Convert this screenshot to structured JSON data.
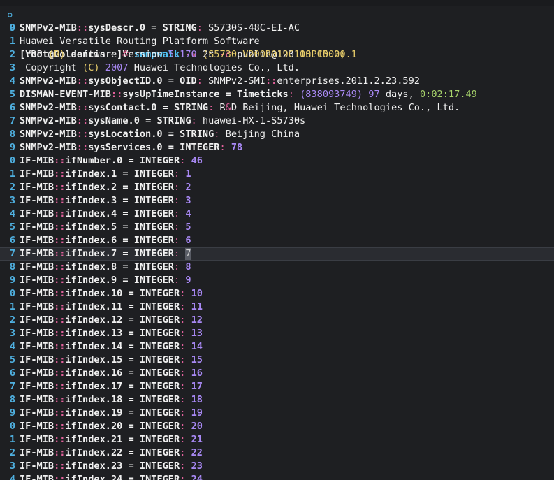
{
  "top_fragment": "- ——————— —— —— —— ——",
  "prompt": {
    "line_number": "9",
    "user_host": "[root@Goldencis ~]",
    "hash": "#",
    "command": "snmpwalk",
    "flag_v": "-v",
    "version": "2c",
    "flag_c": "-c",
    "community": "public@123",
    "target": "10.10.20.1"
  },
  "lines": [
    {
      "gutter": "0",
      "segments": [
        [
          "obj",
          "SNMPv2-MIB"
        ],
        [
          "sep",
          "::"
        ],
        [
          "obj",
          "sysDescr.0 "
        ],
        [
          "eq",
          "= "
        ],
        [
          "type",
          "STRING"
        ],
        [
          "colon",
          ": "
        ],
        [
          "str",
          "S5730S-48C-EI-AC"
        ]
      ]
    },
    {
      "gutter": "1",
      "segments": [
        [
          "plain",
          "Huawei Versatile Routing Platform Software"
        ]
      ]
    },
    {
      "gutter": "2",
      "segments": [
        [
          "plain",
          " VRP "
        ],
        [
          "paren",
          "(R)"
        ],
        [
          "plain",
          " software,Version "
        ],
        [
          "ver",
          "5.170"
        ],
        [
          "plain",
          " "
        ],
        [
          "paren",
          "(S5730 V200R019C10SPC500)"
        ]
      ]
    },
    {
      "gutter": "3",
      "segments": [
        [
          "plain",
          " Copyright "
        ],
        [
          "paren",
          "(C)"
        ],
        [
          "plain",
          " "
        ],
        [
          "ver",
          "2007"
        ],
        [
          "plain",
          " Huawei Technologies Co., Ltd."
        ]
      ]
    },
    {
      "gutter": "4",
      "segments": [
        [
          "obj",
          "SNMPv2-MIB"
        ],
        [
          "sep",
          "::"
        ],
        [
          "obj",
          "sysObjectID.0 "
        ],
        [
          "eq",
          "= "
        ],
        [
          "type",
          "OID"
        ],
        [
          "colon",
          ": "
        ],
        [
          "str",
          "SNMPv2-SMI"
        ],
        [
          "sep",
          "::"
        ],
        [
          "str",
          "enterprises.2011.2.23.592"
        ]
      ]
    },
    {
      "gutter": "5",
      "segments": [
        [
          "obj",
          "DISMAN-EVENT-MIB"
        ],
        [
          "sep",
          "::"
        ],
        [
          "obj",
          "sysUpTimeInstance "
        ],
        [
          "eq",
          "= "
        ],
        [
          "type",
          "Timeticks"
        ],
        [
          "colon",
          ": "
        ],
        [
          "ts",
          "(838093749)"
        ],
        [
          "plain",
          " "
        ],
        [
          "ts",
          "97"
        ],
        [
          "plain",
          " days, "
        ],
        [
          "ts2",
          "0:02:17.49"
        ]
      ]
    },
    {
      "gutter": "6",
      "segments": [
        [
          "obj",
          "SNMPv2-MIB"
        ],
        [
          "sep",
          "::"
        ],
        [
          "obj",
          "sysContact.0 "
        ],
        [
          "eq",
          "= "
        ],
        [
          "type",
          "STRING"
        ],
        [
          "colon",
          ": "
        ],
        [
          "str",
          "R"
        ],
        [
          "amp",
          "&"
        ],
        [
          "str",
          "D Beijing, Huawei Technologies Co., Ltd."
        ]
      ]
    },
    {
      "gutter": "7",
      "segments": [
        [
          "obj",
          "SNMPv2-MIB"
        ],
        [
          "sep",
          "::"
        ],
        [
          "obj",
          "sysName.0 "
        ],
        [
          "eq",
          "= "
        ],
        [
          "type",
          "STRING"
        ],
        [
          "colon",
          ": "
        ],
        [
          "str",
          "huawei-HX-1-S5730s"
        ]
      ]
    },
    {
      "gutter": "8",
      "segments": [
        [
          "obj",
          "SNMPv2-MIB"
        ],
        [
          "sep",
          "::"
        ],
        [
          "obj",
          "sysLocation.0 "
        ],
        [
          "eq",
          "= "
        ],
        [
          "type",
          "STRING"
        ],
        [
          "colon",
          ": "
        ],
        [
          "str",
          "Beijing China"
        ]
      ]
    },
    {
      "gutter": "9",
      "segments": [
        [
          "obj",
          "SNMPv2-MIB"
        ],
        [
          "sep",
          "::"
        ],
        [
          "obj",
          "sysServices.0 "
        ],
        [
          "eq",
          "= "
        ],
        [
          "type",
          "INTEGER"
        ],
        [
          "colon",
          ": "
        ],
        [
          "num",
          "78"
        ]
      ]
    },
    {
      "gutter": "0",
      "segments": [
        [
          "obj",
          "IF-MIB"
        ],
        [
          "sep",
          "::"
        ],
        [
          "obj",
          "ifNumber.0 "
        ],
        [
          "eq",
          "= "
        ],
        [
          "type",
          "INTEGER"
        ],
        [
          "colon",
          ": "
        ],
        [
          "num",
          "46"
        ]
      ]
    },
    {
      "gutter": "1",
      "segments": [
        [
          "obj",
          "IF-MIB"
        ],
        [
          "sep",
          "::"
        ],
        [
          "obj",
          "ifIndex.1 "
        ],
        [
          "eq",
          "= "
        ],
        [
          "type",
          "INTEGER"
        ],
        [
          "colon",
          ": "
        ],
        [
          "num",
          "1"
        ]
      ]
    },
    {
      "gutter": "2",
      "segments": [
        [
          "obj",
          "IF-MIB"
        ],
        [
          "sep",
          "::"
        ],
        [
          "obj",
          "ifIndex.2 "
        ],
        [
          "eq",
          "= "
        ],
        [
          "type",
          "INTEGER"
        ],
        [
          "colon",
          ": "
        ],
        [
          "num",
          "2"
        ]
      ]
    },
    {
      "gutter": "3",
      "segments": [
        [
          "obj",
          "IF-MIB"
        ],
        [
          "sep",
          "::"
        ],
        [
          "obj",
          "ifIndex.3 "
        ],
        [
          "eq",
          "= "
        ],
        [
          "type",
          "INTEGER"
        ],
        [
          "colon",
          ": "
        ],
        [
          "num",
          "3"
        ]
      ]
    },
    {
      "gutter": "4",
      "segments": [
        [
          "obj",
          "IF-MIB"
        ],
        [
          "sep",
          "::"
        ],
        [
          "obj",
          "ifIndex.4 "
        ],
        [
          "eq",
          "= "
        ],
        [
          "type",
          "INTEGER"
        ],
        [
          "colon",
          ": "
        ],
        [
          "num",
          "4"
        ]
      ]
    },
    {
      "gutter": "5",
      "segments": [
        [
          "obj",
          "IF-MIB"
        ],
        [
          "sep",
          "::"
        ],
        [
          "obj",
          "ifIndex.5 "
        ],
        [
          "eq",
          "= "
        ],
        [
          "type",
          "INTEGER"
        ],
        [
          "colon",
          ": "
        ],
        [
          "num",
          "5"
        ]
      ]
    },
    {
      "gutter": "6",
      "segments": [
        [
          "obj",
          "IF-MIB"
        ],
        [
          "sep",
          "::"
        ],
        [
          "obj",
          "ifIndex.6 "
        ],
        [
          "eq",
          "= "
        ],
        [
          "type",
          "INTEGER"
        ],
        [
          "colon",
          ": "
        ],
        [
          "num",
          "6"
        ]
      ]
    },
    {
      "gutter": "7",
      "current": true,
      "segments": [
        [
          "obj",
          "IF-MIB"
        ],
        [
          "sep",
          "::"
        ],
        [
          "obj",
          "ifIndex.7 "
        ],
        [
          "eq",
          "= "
        ],
        [
          "type",
          "INTEGER"
        ],
        [
          "colon",
          ": "
        ],
        [
          "cursor",
          "7"
        ]
      ]
    },
    {
      "gutter": "8",
      "segments": [
        [
          "obj",
          "IF-MIB"
        ],
        [
          "sep",
          "::"
        ],
        [
          "obj",
          "ifIndex.8 "
        ],
        [
          "eq",
          "= "
        ],
        [
          "type",
          "INTEGER"
        ],
        [
          "colon",
          ": "
        ],
        [
          "num",
          "8"
        ]
      ]
    },
    {
      "gutter": "9",
      "segments": [
        [
          "obj",
          "IF-MIB"
        ],
        [
          "sep",
          "::"
        ],
        [
          "obj",
          "ifIndex.9 "
        ],
        [
          "eq",
          "= "
        ],
        [
          "type",
          "INTEGER"
        ],
        [
          "colon",
          ": "
        ],
        [
          "num",
          "9"
        ]
      ]
    },
    {
      "gutter": "0",
      "segments": [
        [
          "obj",
          "IF-MIB"
        ],
        [
          "sep",
          "::"
        ],
        [
          "obj",
          "ifIndex.10 "
        ],
        [
          "eq",
          "= "
        ],
        [
          "type",
          "INTEGER"
        ],
        [
          "colon",
          ": "
        ],
        [
          "num",
          "10"
        ]
      ]
    },
    {
      "gutter": "1",
      "segments": [
        [
          "obj",
          "IF-MIB"
        ],
        [
          "sep",
          "::"
        ],
        [
          "obj",
          "ifIndex.11 "
        ],
        [
          "eq",
          "= "
        ],
        [
          "type",
          "INTEGER"
        ],
        [
          "colon",
          ": "
        ],
        [
          "num",
          "11"
        ]
      ]
    },
    {
      "gutter": "2",
      "segments": [
        [
          "obj",
          "IF-MIB"
        ],
        [
          "sep",
          "::"
        ],
        [
          "obj",
          "ifIndex.12 "
        ],
        [
          "eq",
          "= "
        ],
        [
          "type",
          "INTEGER"
        ],
        [
          "colon",
          ": "
        ],
        [
          "num",
          "12"
        ]
      ]
    },
    {
      "gutter": "3",
      "segments": [
        [
          "obj",
          "IF-MIB"
        ],
        [
          "sep",
          "::"
        ],
        [
          "obj",
          "ifIndex.13 "
        ],
        [
          "eq",
          "= "
        ],
        [
          "type",
          "INTEGER"
        ],
        [
          "colon",
          ": "
        ],
        [
          "num",
          "13"
        ]
      ]
    },
    {
      "gutter": "4",
      "segments": [
        [
          "obj",
          "IF-MIB"
        ],
        [
          "sep",
          "::"
        ],
        [
          "obj",
          "ifIndex.14 "
        ],
        [
          "eq",
          "= "
        ],
        [
          "type",
          "INTEGER"
        ],
        [
          "colon",
          ": "
        ],
        [
          "num",
          "14"
        ]
      ]
    },
    {
      "gutter": "5",
      "segments": [
        [
          "obj",
          "IF-MIB"
        ],
        [
          "sep",
          "::"
        ],
        [
          "obj",
          "ifIndex.15 "
        ],
        [
          "eq",
          "= "
        ],
        [
          "type",
          "INTEGER"
        ],
        [
          "colon",
          ": "
        ],
        [
          "num",
          "15"
        ]
      ]
    },
    {
      "gutter": "6",
      "segments": [
        [
          "obj",
          "IF-MIB"
        ],
        [
          "sep",
          "::"
        ],
        [
          "obj",
          "ifIndex.16 "
        ],
        [
          "eq",
          "= "
        ],
        [
          "type",
          "INTEGER"
        ],
        [
          "colon",
          ": "
        ],
        [
          "num",
          "16"
        ]
      ]
    },
    {
      "gutter": "7",
      "segments": [
        [
          "obj",
          "IF-MIB"
        ],
        [
          "sep",
          "::"
        ],
        [
          "obj",
          "ifIndex.17 "
        ],
        [
          "eq",
          "= "
        ],
        [
          "type",
          "INTEGER"
        ],
        [
          "colon",
          ": "
        ],
        [
          "num",
          "17"
        ]
      ]
    },
    {
      "gutter": "8",
      "segments": [
        [
          "obj",
          "IF-MIB"
        ],
        [
          "sep",
          "::"
        ],
        [
          "obj",
          "ifIndex.18 "
        ],
        [
          "eq",
          "= "
        ],
        [
          "type",
          "INTEGER"
        ],
        [
          "colon",
          ": "
        ],
        [
          "num",
          "18"
        ]
      ]
    },
    {
      "gutter": "9",
      "segments": [
        [
          "obj",
          "IF-MIB"
        ],
        [
          "sep",
          "::"
        ],
        [
          "obj",
          "ifIndex.19 "
        ],
        [
          "eq",
          "= "
        ],
        [
          "type",
          "INTEGER"
        ],
        [
          "colon",
          ": "
        ],
        [
          "num",
          "19"
        ]
      ]
    },
    {
      "gutter": "0",
      "segments": [
        [
          "obj",
          "IF-MIB"
        ],
        [
          "sep",
          "::"
        ],
        [
          "obj",
          "ifIndex.20 "
        ],
        [
          "eq",
          "= "
        ],
        [
          "type",
          "INTEGER"
        ],
        [
          "colon",
          ": "
        ],
        [
          "num",
          "20"
        ]
      ]
    },
    {
      "gutter": "1",
      "segments": [
        [
          "obj",
          "IF-MIB"
        ],
        [
          "sep",
          "::"
        ],
        [
          "obj",
          "ifIndex.21 "
        ],
        [
          "eq",
          "= "
        ],
        [
          "type",
          "INTEGER"
        ],
        [
          "colon",
          ": "
        ],
        [
          "num",
          "21"
        ]
      ]
    },
    {
      "gutter": "2",
      "segments": [
        [
          "obj",
          "IF-MIB"
        ],
        [
          "sep",
          "::"
        ],
        [
          "obj",
          "ifIndex.22 "
        ],
        [
          "eq",
          "= "
        ],
        [
          "type",
          "INTEGER"
        ],
        [
          "colon",
          ": "
        ],
        [
          "num",
          "22"
        ]
      ]
    },
    {
      "gutter": "3",
      "segments": [
        [
          "obj",
          "IF-MIB"
        ],
        [
          "sep",
          "::"
        ],
        [
          "obj",
          "ifIndex.23 "
        ],
        [
          "eq",
          "= "
        ],
        [
          "type",
          "INTEGER"
        ],
        [
          "colon",
          ": "
        ],
        [
          "num",
          "23"
        ]
      ]
    },
    {
      "gutter": "4",
      "segments": [
        [
          "obj",
          "IF-MIB"
        ],
        [
          "sep",
          "::"
        ],
        [
          "obj",
          "ifIndex.24 "
        ],
        [
          "eq",
          "= "
        ],
        [
          "type",
          "INTEGER"
        ],
        [
          "colon",
          ": "
        ],
        [
          "num",
          "24"
        ]
      ]
    }
  ]
}
